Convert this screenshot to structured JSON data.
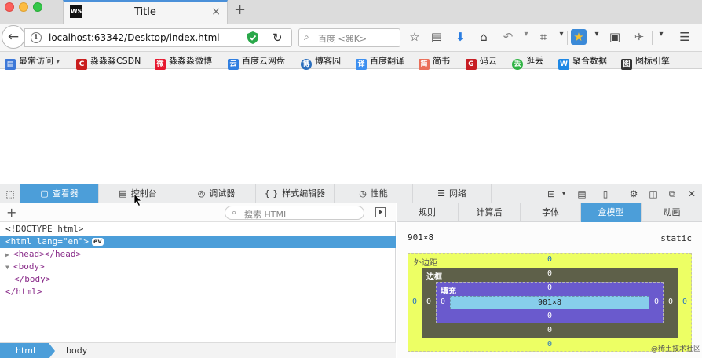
{
  "window": {
    "tab_favicon": "WS",
    "tab_title": "Title",
    "tab_close": "×",
    "new_tab": "+"
  },
  "navbar": {
    "url": "localhost:63342/Desktop/index.html",
    "search_placeholder": "百度 <⌘K>"
  },
  "bookmarks": [
    {
      "label": "最常访问",
      "icon_color": "#3d78d8",
      "icon_text": "▤",
      "dropdown": "▾"
    },
    {
      "label": "淼淼淼CSDN",
      "icon_color": "#c91e1e",
      "icon_text": "C"
    },
    {
      "label": "淼淼淼微博",
      "icon_color": "#e6162d",
      "icon_text": "微"
    },
    {
      "label": "百度云网盘",
      "icon_color": "#2f7ee0",
      "icon_text": "云"
    },
    {
      "label": "博客园",
      "icon_color": "#2a6ebd",
      "icon_text": "博"
    },
    {
      "label": "百度翻译",
      "icon_color": "#3c8ff0",
      "icon_text": "译"
    },
    {
      "label": "简书",
      "icon_color": "#ea6f5a",
      "icon_text": "简"
    },
    {
      "label": "码云",
      "icon_color": "#c71d23",
      "icon_text": "G"
    },
    {
      "label": "逛丢",
      "icon_color": "#2fb344",
      "icon_text": "丢"
    },
    {
      "label": "聚合数据",
      "icon_color": "#1e88e5",
      "icon_text": "W"
    },
    {
      "label": "图标引擎",
      "icon_color": "#333333",
      "icon_text": "图"
    }
  ],
  "devtools": {
    "tabs": [
      {
        "label": "查看器",
        "icon": "▢",
        "active": true
      },
      {
        "label": "控制台",
        "icon": "▤",
        "active": false
      },
      {
        "label": "调试器",
        "icon": "◎",
        "active": false
      },
      {
        "label": "样式编辑器",
        "icon": "{ }",
        "active": false
      },
      {
        "label": "性能",
        "icon": "◷",
        "active": false
      },
      {
        "label": "网络",
        "icon": "☰",
        "active": false
      }
    ],
    "search_placeholder": "搜索 HTML",
    "markup": {
      "doctype": "<!DOCTYPE html>",
      "html_open": "<html lang=\"en\">",
      "ev_badge": "ev",
      "head": "<head></head>",
      "body_open": "<body>",
      "body_close": "</body>",
      "html_close": "</html>"
    },
    "breadcrumbs": [
      "html",
      "body"
    ],
    "side_tabs": [
      {
        "label": "规则",
        "active": false
      },
      {
        "label": "计算后",
        "active": false
      },
      {
        "label": "字体",
        "active": false
      },
      {
        "label": "盒模型",
        "active": true
      },
      {
        "label": "动画",
        "active": false
      }
    ],
    "box_model": {
      "dimensions": "901×8",
      "position": "static",
      "margin_label": "外边距",
      "border_label": "边框",
      "padding_label": "填充",
      "content": "901×8",
      "margin": {
        "top": "0",
        "right": "0",
        "bottom": "0",
        "left": "0"
      },
      "border": {
        "top": "0",
        "right": "0",
        "bottom": "0",
        "left": "0"
      },
      "padding": {
        "top": "0",
        "right": "0",
        "bottom": "0",
        "left": "0"
      },
      "colors": {
        "margin": "#edff64",
        "border": "#444444",
        "padding": "#6a5acd",
        "content": "#87ceeb"
      }
    },
    "watermark": "@稀土技术社区"
  }
}
